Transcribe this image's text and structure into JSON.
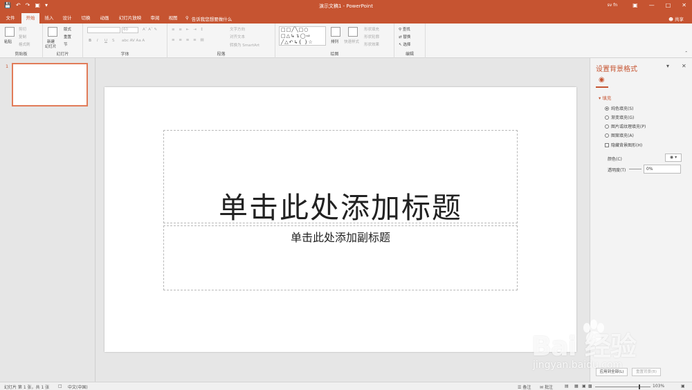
{
  "window": {
    "title": "演示文稿1  -  PowerPoint",
    "user": "sv fn",
    "controls": [
      "minimize-icon",
      "maximize-icon",
      "close-icon"
    ]
  },
  "qat": {
    "icons": [
      "save-icon",
      "undo-icon",
      "redo-icon",
      "present-icon",
      "customize-icon"
    ]
  },
  "tabs": [
    "文件",
    "开始",
    "插入",
    "设计",
    "切换",
    "动画",
    "幻灯片放映",
    "审阅",
    "视图"
  ],
  "tell_me": "告诉我您想要做什么",
  "share": "共享",
  "ribbon": {
    "clipboard": {
      "paste": "粘贴",
      "cut": "剪切",
      "copy": "复制",
      "format_painter": "格式刷",
      "label": "剪贴板"
    },
    "slides": {
      "new_slide": "新建",
      "new_slide_2": "幻灯片",
      "layout": "版式",
      "reset": "重置",
      "section": "节",
      "label": "幻灯片"
    },
    "font": {
      "size": "60",
      "bold": "B",
      "italic": "I",
      "underline": "U",
      "strike": "S",
      "label": "字体"
    },
    "paragraph": {
      "text_direction": "文字方向",
      "align_text": "对齐文本",
      "smartart": "转换为 SmartArt",
      "label": "段落"
    },
    "drawing": {
      "arrange": "排列",
      "quick_styles": "快速样式",
      "shape_fill": "形状填充",
      "shape_outline": "形状轮廓",
      "shape_effects": "形状效果",
      "label": "绘图"
    },
    "editing": {
      "find": "查找",
      "replace": "替换",
      "select": "选择",
      "label": "编辑"
    }
  },
  "thumbnail": {
    "number": "1"
  },
  "slide": {
    "title_placeholder": "单击此处添加标题",
    "subtitle_placeholder": "单击此处添加副标题"
  },
  "format_pane": {
    "title": "设置背景格式",
    "section": "填充",
    "options": [
      "纯色填充(S)",
      "渐变填充(G)",
      "图片或纹理填充(P)",
      "图案填充(A)"
    ],
    "selected_option": 0,
    "hide_graphics": "隐藏背景图形(H)",
    "color_label": "颜色(C)",
    "transparency_label": "透明度(T)",
    "transparency_value": "0%",
    "apply_all": "应用到全部(L)",
    "reset_bg": "重置背景(B)"
  },
  "statusbar": {
    "slide_info": "幻灯片 第 1 张，共 1 张",
    "language": "中文(中国)",
    "notes": "备注",
    "comments": "批注",
    "zoom": "103%"
  },
  "watermark": {
    "brand": "Bai  经验",
    "url": "jingyan.baidu.com"
  },
  "colors": {
    "accent": "#c65431",
    "thumb_border": "#e17b58"
  }
}
